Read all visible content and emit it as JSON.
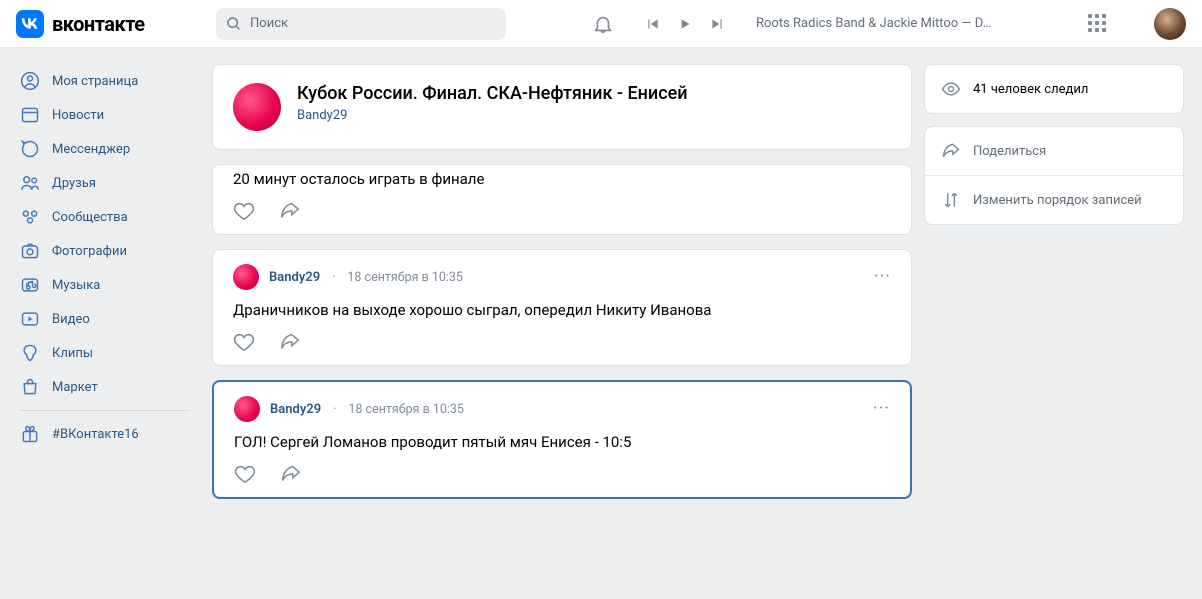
{
  "header": {
    "logo_text": "вконтакте",
    "search_placeholder": "Поиск",
    "now_playing": "Roots Radics Band & Jackie Mittoo — D…"
  },
  "sidebar": {
    "items": [
      {
        "label": "Моя страница",
        "icon": "profile"
      },
      {
        "label": "Новости",
        "icon": "news"
      },
      {
        "label": "Мессенджер",
        "icon": "messenger"
      },
      {
        "label": "Друзья",
        "icon": "friends"
      },
      {
        "label": "Сообщества",
        "icon": "communities"
      },
      {
        "label": "Фотографии",
        "icon": "photos"
      },
      {
        "label": "Музыка",
        "icon": "music"
      },
      {
        "label": "Видео",
        "icon": "video"
      },
      {
        "label": "Клипы",
        "icon": "clips"
      },
      {
        "label": "Маркет",
        "icon": "market"
      }
    ],
    "extra": {
      "label": "#ВКонтакте16",
      "icon": "gift"
    }
  },
  "topic": {
    "title": "Кубок России. Финал. СКА-Нефтяник - Енисей",
    "author": "Bandy29"
  },
  "posts": [
    {
      "author": "",
      "date": "",
      "body": "20 минут осталось играть в финале",
      "highlighted": false,
      "cut_top": true
    },
    {
      "author": "Bandy29",
      "date": "18 сентября в 10:35",
      "body": "Драничников на выходе хорошо сыграл, опередил Никиту Иванова",
      "highlighted": false
    },
    {
      "author": "Bandy29",
      "date": "18 сентября в 10:35",
      "body": "ГОЛ! Сергей Ломанов проводит пятый мяч Енисея - 10:5",
      "highlighted": true
    }
  ],
  "rightcol": {
    "followers": "41 человек следил",
    "share": "Поделиться",
    "reorder": "Изменить порядок записей"
  }
}
